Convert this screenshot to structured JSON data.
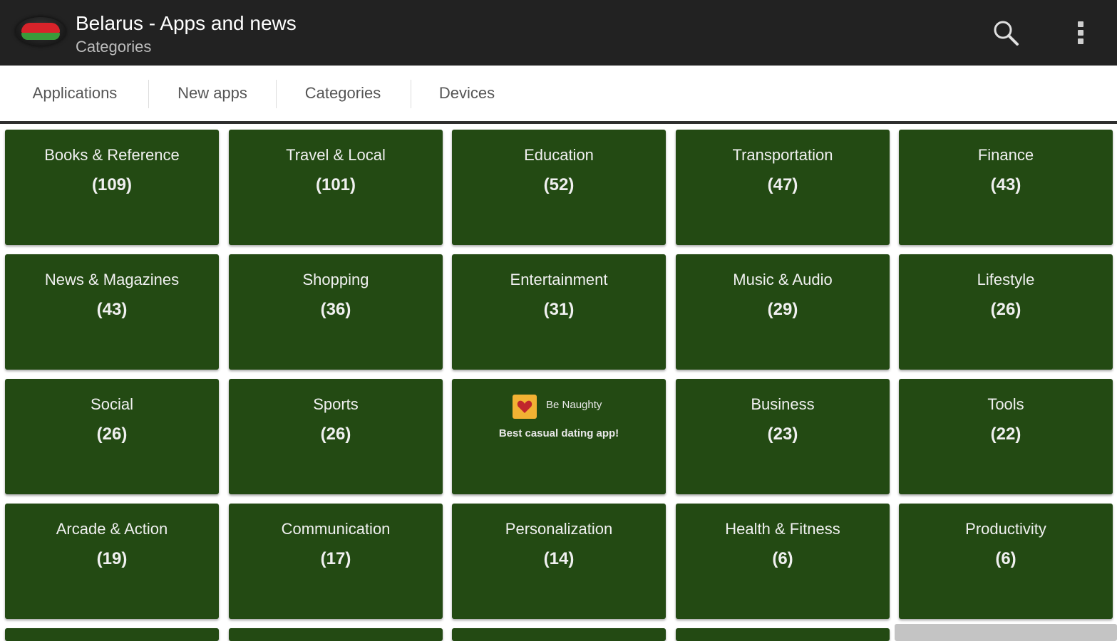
{
  "app": {
    "title": "Belarus - Apps and news",
    "subtitle": "Categories",
    "logo_icon": "belarus-flag-icon",
    "actions": [
      {
        "icon": "search-icon"
      },
      {
        "icon": "overflow-menu-icon"
      }
    ]
  },
  "tabs": [
    {
      "label": "Applications"
    },
    {
      "label": "New apps"
    },
    {
      "label": "Categories"
    },
    {
      "label": "Devices"
    }
  ],
  "colors": {
    "action_bar": "#222222",
    "tile_green": "#234a13",
    "tab_text": "#555555"
  },
  "categories": [
    {
      "name": "Books & Reference",
      "count": "(109)"
    },
    {
      "name": "Travel & Local",
      "count": "(101)"
    },
    {
      "name": "Education",
      "count": "(52)"
    },
    {
      "name": "Transportation",
      "count": "(47)"
    },
    {
      "name": "Finance",
      "count": "(43)"
    },
    {
      "name": "News & Magazines",
      "count": "(43)"
    },
    {
      "name": "Shopping",
      "count": "(36)"
    },
    {
      "name": "Entertainment",
      "count": "(31)"
    },
    {
      "name": "Music & Audio",
      "count": "(29)"
    },
    {
      "name": "Lifestyle",
      "count": "(26)"
    },
    {
      "name": "Social",
      "count": "(26)"
    },
    {
      "name": "Sports",
      "count": "(26)"
    },
    {
      "name": "Business",
      "count": "(23)"
    },
    {
      "name": "Tools",
      "count": "(22)"
    },
    {
      "name": "Arcade & Action",
      "count": "(19)"
    },
    {
      "name": "Communication",
      "count": "(17)"
    },
    {
      "name": "Personalization",
      "count": "(14)"
    },
    {
      "name": "Health & Fitness",
      "count": "(6)"
    },
    {
      "name": "Productivity",
      "count": "(6)"
    }
  ],
  "ad": {
    "name": "Be Naughty",
    "tagline": "Best casual dating app!",
    "icon": "heart-icon"
  }
}
